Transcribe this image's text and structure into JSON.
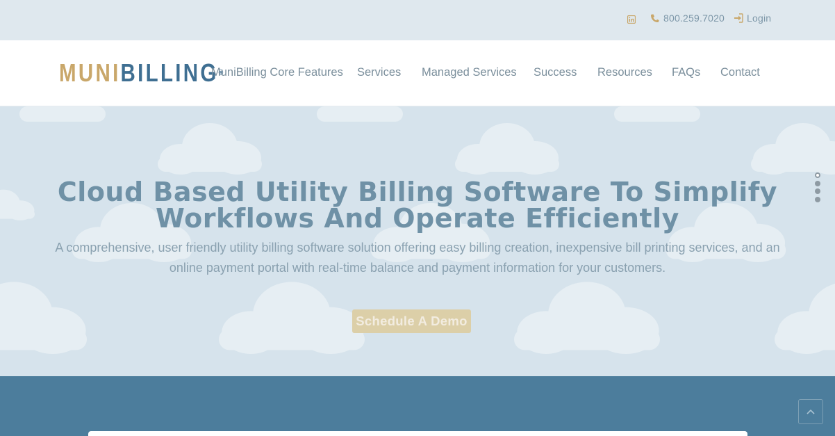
{
  "topbar": {
    "phone": "800.259.7020",
    "login": "Login",
    "icons": [
      "linkedin-icon",
      "phone-icon",
      "login-icon"
    ]
  },
  "header": {
    "logo": {
      "part1": "MUNI",
      "part2": "BILLING",
      "reg": "®"
    },
    "nav": [
      "MuniBilling Core Features",
      "Services",
      "Managed Services",
      "Success",
      "Resources",
      "FAQs",
      "Contact"
    ]
  },
  "hero": {
    "title_line1": "Cloud Based Utility Billing Software To Simplify",
    "title_line2": "Workflows And Operate Efficiently",
    "subtitle_line1": "A comprehensive, user friendly utility billing software solution offering easy billing creation, inexpensive bill printing services, and an",
    "subtitle_line2": "online payment portal with real-time balance and payment information for your customers.",
    "cta": "Schedule A Demo"
  },
  "colors": {
    "gold": "#c9a76a",
    "brand_blue": "#3f6f92",
    "band_blue": "#4c7d9c",
    "hero_bg": "#d6e3ec"
  }
}
